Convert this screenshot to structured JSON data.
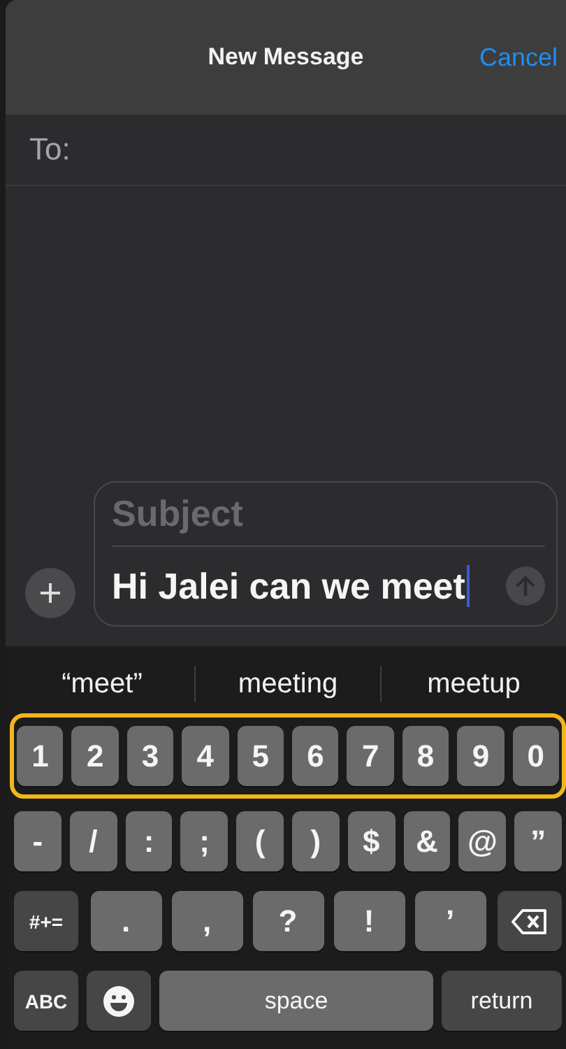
{
  "nav": {
    "title": "New Message",
    "cancel": "Cancel"
  },
  "to": {
    "label": "To:"
  },
  "composer": {
    "subject_placeholder": "Subject",
    "message": "Hi Jalei can we meet"
  },
  "suggestions": [
    "“meet”",
    "meeting",
    "meetup"
  ],
  "keyboard": {
    "rows": [
      {
        "highlighted": true,
        "keys": [
          {
            "kind": "char",
            "label": "1"
          },
          {
            "kind": "char",
            "label": "2"
          },
          {
            "kind": "char",
            "label": "3"
          },
          {
            "kind": "char",
            "label": "4"
          },
          {
            "kind": "char",
            "label": "5"
          },
          {
            "kind": "char",
            "label": "6"
          },
          {
            "kind": "char",
            "label": "7"
          },
          {
            "kind": "char",
            "label": "8"
          },
          {
            "kind": "char",
            "label": "9"
          },
          {
            "kind": "char",
            "label": "0"
          }
        ]
      },
      {
        "highlighted": false,
        "keys": [
          {
            "kind": "char",
            "label": "-"
          },
          {
            "kind": "char",
            "label": "/"
          },
          {
            "kind": "char",
            "label": ":"
          },
          {
            "kind": "char",
            "label": ";"
          },
          {
            "kind": "char",
            "label": "("
          },
          {
            "kind": "char",
            "label": ")"
          },
          {
            "kind": "char",
            "label": "$"
          },
          {
            "kind": "char",
            "label": "&"
          },
          {
            "kind": "char",
            "label": "@"
          },
          {
            "kind": "char",
            "label": "”"
          }
        ]
      },
      {
        "highlighted": false,
        "keys": [
          {
            "kind": "mode",
            "label": "#+="
          },
          {
            "kind": "wide",
            "label": "."
          },
          {
            "kind": "wide",
            "label": ","
          },
          {
            "kind": "wide",
            "label": "?"
          },
          {
            "kind": "wide",
            "label": "!"
          },
          {
            "kind": "wide",
            "label": "’"
          },
          {
            "kind": "delete"
          }
        ]
      },
      {
        "highlighted": false,
        "keys": [
          {
            "kind": "mode",
            "label": "ABC"
          },
          {
            "kind": "emoji"
          },
          {
            "kind": "space",
            "label": "space"
          },
          {
            "kind": "return",
            "label": "return"
          }
        ]
      }
    ]
  }
}
